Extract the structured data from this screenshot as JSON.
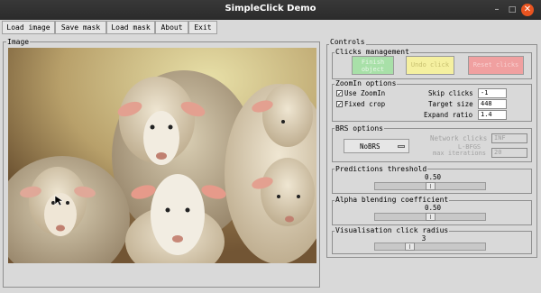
{
  "window": {
    "title": "SimpleClick Demo",
    "controls": {
      "minimize": "–",
      "maximize": "□",
      "close": "✕"
    }
  },
  "menu": {
    "items": [
      {
        "id": "load-image",
        "label": "Load image"
      },
      {
        "id": "save-mask",
        "label": "Save mask"
      },
      {
        "id": "load-mask",
        "label": "Load mask"
      },
      {
        "id": "about",
        "label": "About"
      },
      {
        "id": "exit",
        "label": "Exit"
      }
    ]
  },
  "image_panel": {
    "label": "Image",
    "content": "sheep-photo"
  },
  "controls": {
    "label": "Controls",
    "clicks_management": {
      "label": "Clicks management",
      "finish_object": {
        "line1": "Finish",
        "line2": "object",
        "color": "#a8e0a8"
      },
      "undo_click": {
        "label": "Undo click",
        "color": "#f5f0a0"
      },
      "reset_clicks": {
        "label": "Reset clicks",
        "color": "#f0a0a0"
      }
    },
    "zoomin": {
      "label": "ZoomIn options",
      "use_zoomin": {
        "label": "Use ZoomIn",
        "checked": true
      },
      "fixed_crop": {
        "label": "Fixed crop",
        "checked": true
      },
      "skip_clicks": {
        "label": "Skip clicks",
        "value": "-1"
      },
      "target_size": {
        "label": "Target size",
        "value": "448"
      },
      "expand_ratio": {
        "label": "Expand ratio",
        "value": "1.4"
      }
    },
    "brs": {
      "label": "BRS options",
      "mode": "NoBRS",
      "network_clicks": {
        "label": "Network clicks",
        "value": "INF"
      },
      "lbfgs": {
        "line1": "L-BFGS",
        "line2": "max iterations",
        "value": "20"
      }
    },
    "predictions_threshold": {
      "label": "Predictions threshold",
      "value": "0.50",
      "fraction": 0.5
    },
    "alpha_blending": {
      "label": "Alpha blending coefficient",
      "value": "0.50",
      "fraction": 0.5
    },
    "click_radius": {
      "label": "Visualisation click radius",
      "value": "3",
      "fraction": 0.3
    }
  }
}
